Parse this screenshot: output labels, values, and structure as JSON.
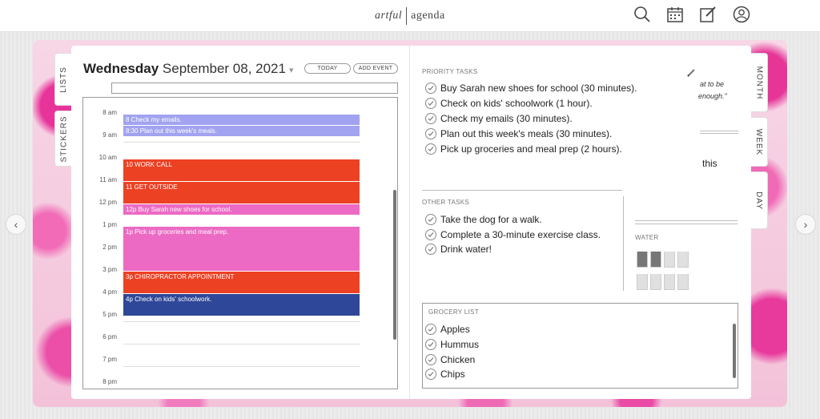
{
  "brand": {
    "part1": "artful",
    "part2": "agenda"
  },
  "left_tabs": [
    "LISTS",
    "STICKERS"
  ],
  "right_tabs": [
    "MONTH",
    "WEEK",
    "DAY"
  ],
  "header": {
    "day": "Wednesday",
    "date": "September 08, 2021",
    "today_label": "TODAY",
    "add_event_label": "ADD EVENT"
  },
  "hours": [
    "8 am",
    "9 am",
    "10 am",
    "11 am",
    "12 pm",
    "1 pm",
    "2 pm",
    "3 pm",
    "4 pm",
    "5 pm",
    "6 pm",
    "7 pm",
    "8 pm"
  ],
  "events": [
    {
      "label": "8 Check my emails.",
      "color": "#a1a3f0"
    },
    {
      "label": "8:30 Plan out this week's meals.",
      "color": "#a1a3f0"
    },
    {
      "label": "10 WORK CALL",
      "color": "#ec4123"
    },
    {
      "label": "11 GET OUTSIDE",
      "color": "#ec4123"
    },
    {
      "label": "12p Buy Sarah new shoes for school.",
      "color": "#ec6ac4"
    },
    {
      "label": "1p Pick up groceries and meal prep.",
      "color": "#ec6ac4"
    },
    {
      "label": "3p CHIROPRACTOR APPOINTMENT",
      "color": "#ec4123"
    },
    {
      "label": "4p Check on kids' schoolwork.",
      "color": "#2e4798"
    }
  ],
  "priority": {
    "label": "PRIORITY TASKS",
    "tasks": [
      "Buy Sarah new shoes for school (30 minutes).",
      "Check on kids' schoolwork (1 hour).",
      "Check my emails (30 minutes).",
      "Plan out this week's meals (30 minutes).",
      "Pick up groceries and meal prep (2 hours)."
    ]
  },
  "side_notes": {
    "line1": "at to be",
    "line2": "enough.\"",
    "line3": "this"
  },
  "other": {
    "label": "OTHER TASKS",
    "tasks": [
      "Take the dog for a walk.",
      "Complete a 30-minute exercise class.",
      "Drink water!"
    ]
  },
  "water": {
    "label": "WATER",
    "glasses_total": 8,
    "glasses_full": 2
  },
  "grocery": {
    "label": "GROCERY LIST",
    "items": [
      "Apples",
      "Hummus",
      "Chicken",
      "Chips"
    ]
  }
}
